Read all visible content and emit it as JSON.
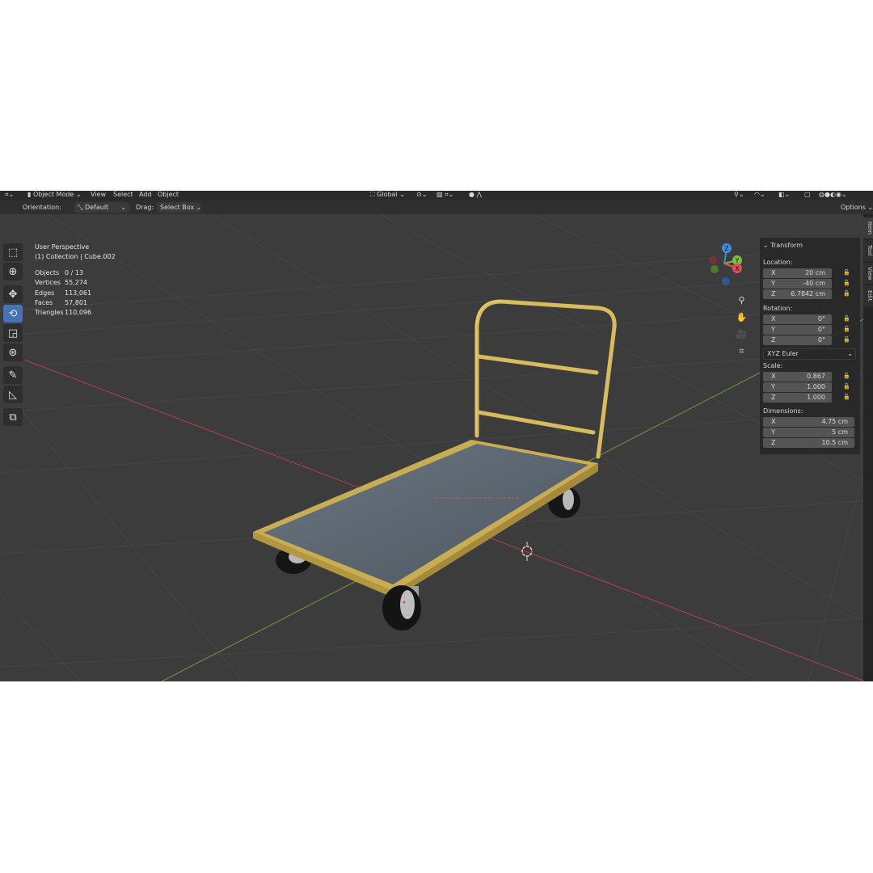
{
  "header": {
    "mode_label": "Object Mode",
    "menus": [
      "View",
      "Select",
      "Add",
      "Object"
    ],
    "transform_space": "Global"
  },
  "tool_settings": {
    "orientation_label": "Orientation:",
    "orientation_value": "Default",
    "drag_label": "Drag:",
    "drag_value": "Select Box",
    "options_label": "Options"
  },
  "viewport": {
    "view_name": "User Perspective",
    "collection_path": "(1) Collection | Cube.002",
    "stats": [
      {
        "label": "Objects",
        "value": "0 / 13"
      },
      {
        "label": "Vertices",
        "value": "55,274"
      },
      {
        "label": "Edges",
        "value": "113,061"
      },
      {
        "label": "Faces",
        "value": "57,801"
      },
      {
        "label": "Triangles",
        "value": "110,096"
      }
    ],
    "gizmo": {
      "x": "X",
      "y": "Y",
      "z": "Z"
    }
  },
  "transform_panel": {
    "title": "Transform",
    "location_label": "Location:",
    "location": [
      {
        "axis": "X",
        "value": "20 cm"
      },
      {
        "axis": "Y",
        "value": "-40 cm"
      },
      {
        "axis": "Z",
        "value": "6.7842 cm"
      }
    ],
    "rotation_label": "Rotation:",
    "rotation": [
      {
        "axis": "X",
        "value": "0°"
      },
      {
        "axis": "Y",
        "value": "0°"
      },
      {
        "axis": "Z",
        "value": "0°"
      }
    ],
    "rotation_mode": "XYZ Euler",
    "scale_label": "Scale:",
    "scale": [
      {
        "axis": "X",
        "value": "0.867"
      },
      {
        "axis": "Y",
        "value": "1.000"
      },
      {
        "axis": "Z",
        "value": "1.000"
      }
    ],
    "dimensions_label": "Dimensions:",
    "dimensions": [
      {
        "axis": "X",
        "value": "4.75 cm"
      },
      {
        "axis": "Y",
        "value": "5 cm"
      },
      {
        "axis": "Z",
        "value": "10.5 cm"
      }
    ]
  },
  "sidebar_tabs": [
    "Item",
    "Tool",
    "View",
    "Edit"
  ],
  "colors": {
    "accent": "#4772b3",
    "axis_x": "#e04e5e",
    "axis_y": "#7fbf3f",
    "axis_z": "#3d8fe0",
    "cart_frame": "#d8bb5e"
  }
}
